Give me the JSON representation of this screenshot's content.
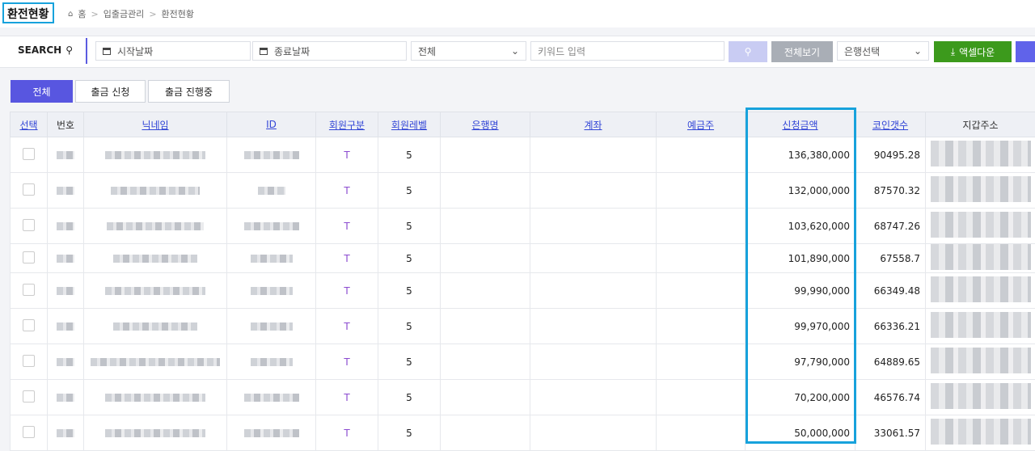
{
  "header": {
    "title": "환전현황",
    "breadcrumb": [
      "홈",
      "입출금관리",
      "환전현황"
    ]
  },
  "search": {
    "label": "SEARCH",
    "start_date_placeholder": "시작날짜",
    "end_date_placeholder": "종료날짜",
    "filter_selected": "전체",
    "keyword_placeholder": "키워드 입력",
    "view_all_label": "전체보기",
    "bank_select": "은행선택",
    "excel_label": "액셀다운"
  },
  "tabs": [
    "전체",
    "출금 신청",
    "출금 진행중"
  ],
  "table": {
    "columns": [
      "선택",
      "번호",
      "닉네임",
      "ID",
      "회원구분",
      "회원레벨",
      "은행명",
      "계좌",
      "예금주",
      "신청금액",
      "코인갯수",
      "지갑주소"
    ],
    "rows": [
      {
        "type": "T",
        "level": "5",
        "amount": "136,380,000",
        "coins": "90495.28"
      },
      {
        "type": "T",
        "level": "5",
        "amount": "132,000,000",
        "coins": "87570.32"
      },
      {
        "type": "T",
        "level": "5",
        "amount": "103,620,000",
        "coins": "68747.26"
      },
      {
        "type": "T",
        "level": "5",
        "amount": "101,890,000",
        "coins": "67558.7"
      },
      {
        "type": "T",
        "level": "5",
        "amount": "99,990,000",
        "coins": "66349.48"
      },
      {
        "type": "T",
        "level": "5",
        "amount": "99,970,000",
        "coins": "66336.21"
      },
      {
        "type": "T",
        "level": "5",
        "amount": "97,790,000",
        "coins": "64889.65"
      },
      {
        "type": "T",
        "level": "5",
        "amount": "70,200,000",
        "coins": "46576.74"
      },
      {
        "type": "T",
        "level": "5",
        "amount": "50,000,000",
        "coins": "33061.57"
      }
    ]
  },
  "colors": {
    "accent": "#5856e0",
    "highlight": "#17a2dc",
    "excel": "#3c9a1c",
    "link": "#3346d6"
  }
}
